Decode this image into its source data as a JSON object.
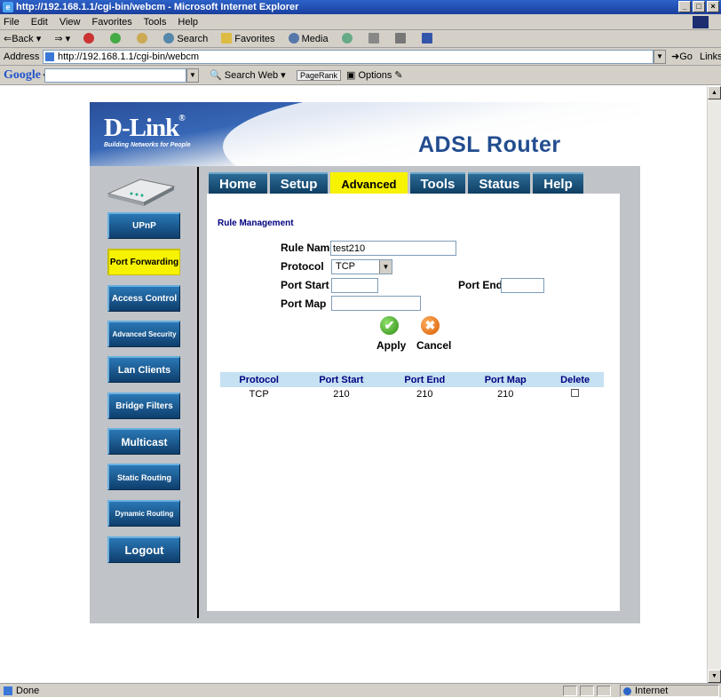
{
  "browser": {
    "title": "http://192.168.1.1/cgi-bin/webcm - Microsoft Internet Explorer",
    "menu": [
      "File",
      "Edit",
      "View",
      "Favorites",
      "Tools",
      "Help"
    ],
    "toolbar": {
      "back": "Back",
      "search": "Search",
      "favorites": "Favorites",
      "media": "Media"
    },
    "address_label": "Address",
    "address": "http://192.168.1.1/cgi-bin/webcm",
    "go": "Go",
    "links": "Links",
    "google": {
      "logo": "Google",
      "search_web": "Search Web",
      "pagerank": "PageRank",
      "options": "Options"
    },
    "status_text": "Done",
    "zone": "Internet"
  },
  "header": {
    "logo": "D-Link",
    "tagline": "Building Networks for People",
    "product": "ADSL Router"
  },
  "tabs": [
    {
      "label": "Home",
      "active": false
    },
    {
      "label": "Setup",
      "active": false
    },
    {
      "label": "Advanced",
      "active": true
    },
    {
      "label": "Tools",
      "active": false
    },
    {
      "label": "Status",
      "active": false
    },
    {
      "label": "Help",
      "active": false
    }
  ],
  "sidebar": [
    {
      "label": "UPnP",
      "active": false
    },
    {
      "label": "Port Forwarding",
      "active": true
    },
    {
      "label": "Access Control",
      "active": false
    },
    {
      "label": "Advanced Security",
      "active": false
    },
    {
      "label": "Lan Clients",
      "active": false
    },
    {
      "label": "Bridge Filters",
      "active": false
    },
    {
      "label": "Multicast",
      "active": false
    },
    {
      "label": "Static Routing",
      "active": false
    },
    {
      "label": "Dynamic Routing",
      "active": false
    },
    {
      "label": "Logout",
      "active": false
    }
  ],
  "form": {
    "section_title": "Rule Management",
    "rule_name_label": "Rule Name",
    "rule_name_value": "test210",
    "protocol_label": "Protocol",
    "protocol_value": "TCP",
    "port_start_label": "Port Start",
    "port_start_value": "",
    "port_end_label": "Port End",
    "port_end_value": "",
    "port_map_label": "Port Map",
    "port_map_value": "",
    "apply_label": "Apply",
    "cancel_label": "Cancel"
  },
  "table": {
    "headers": [
      "Protocol",
      "Port Start",
      "Port End",
      "Port Map",
      "Delete"
    ],
    "rows": [
      {
        "protocol": "TCP",
        "port_start": "210",
        "port_end": "210",
        "port_map": "210",
        "delete": false
      }
    ]
  },
  "colors": {
    "tab_active": "#f7f200",
    "tab_bg": "#1c5a86",
    "section_title": "#000080",
    "table_header_bg": "#c5e1f2"
  }
}
